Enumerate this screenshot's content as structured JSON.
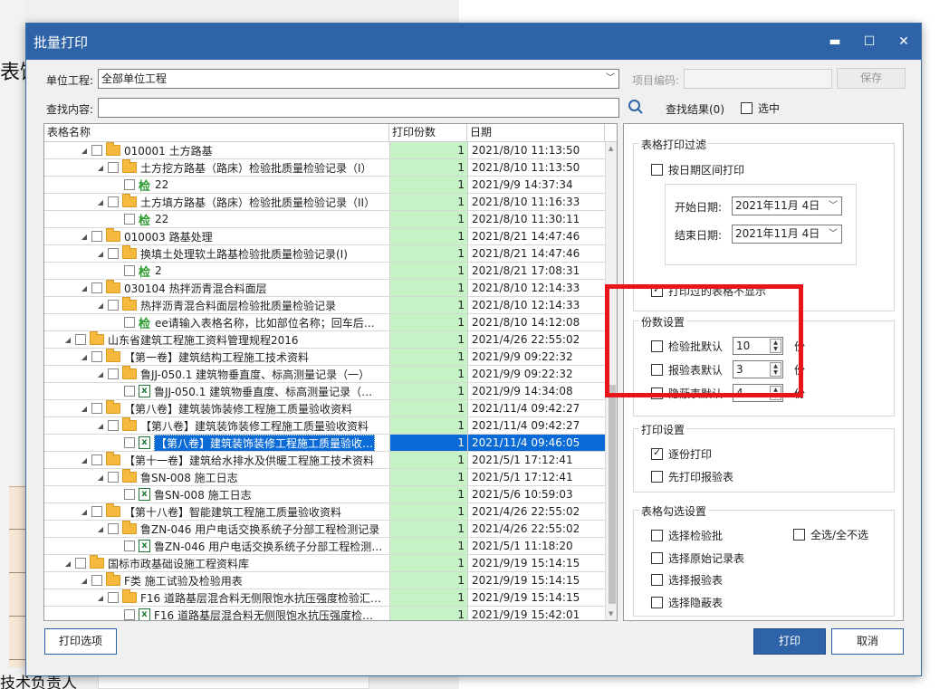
{
  "background": {
    "title_fragment": "表饰",
    "footer_fragment": "技术负责人"
  },
  "dialog": {
    "title": "批量打印",
    "minimize_glyph": "▬",
    "maximize_glyph": "☐",
    "close_glyph": "✕"
  },
  "filter": {
    "unit_label": "单位工程:",
    "unit_value": "全部单位工程",
    "project_code_label": "项目编码:",
    "project_code_value": "",
    "save_label": "保存",
    "search_label": "查找内容:",
    "search_value": "",
    "result_label": "查找结果(0)",
    "select_label": "选中"
  },
  "grid": {
    "headers": [
      "表格名称",
      "打印份数",
      "日期"
    ],
    "rows": [
      {
        "indent": 2,
        "expander": "◢",
        "icon": "folder",
        "name": "010001 土方路基",
        "copies": "1",
        "date": "2021/8/10 11:13:50"
      },
      {
        "indent": 3,
        "expander": "◢",
        "icon": "folder",
        "name": "土方挖方路基（路床）检验批质量检验记录（I）",
        "copies": "1",
        "date": "2021/8/10 11:13:50"
      },
      {
        "indent": 4,
        "expander": "",
        "icon": "jian",
        "name": "22",
        "copies": "1",
        "date": "2021/9/9 14:37:34"
      },
      {
        "indent": 3,
        "expander": "◢",
        "icon": "folder",
        "name": "土方填方路基（路床）检验批质量检验记录（II）",
        "copies": "1",
        "date": "2021/8/10 11:16:33"
      },
      {
        "indent": 4,
        "expander": "",
        "icon": "jian",
        "name": "22",
        "copies": "1",
        "date": "2021/8/10 11:30:11"
      },
      {
        "indent": 2,
        "expander": "◢",
        "icon": "folder",
        "name": "010003 路基处理",
        "copies": "1",
        "date": "2021/8/21 14:47:46"
      },
      {
        "indent": 3,
        "expander": "◢",
        "icon": "folder",
        "name": "换填土处理软土路基检验批质量检验记录(I)",
        "copies": "1",
        "date": "2021/8/21 14:47:46"
      },
      {
        "indent": 4,
        "expander": "",
        "icon": "jian",
        "name": "2",
        "copies": "1",
        "date": "2021/8/21 17:08:31"
      },
      {
        "indent": 2,
        "expander": "◢",
        "icon": "folder",
        "name": "030104 热拌沥青混合料面层",
        "copies": "1",
        "date": "2021/8/10 12:14:33"
      },
      {
        "indent": 3,
        "expander": "◢",
        "icon": "folder",
        "name": "热拌沥青混合料面层检验批质量检验记录",
        "copies": "1",
        "date": "2021/8/10 12:14:33"
      },
      {
        "indent": 4,
        "expander": "",
        "icon": "jian",
        "name": "ee请输入表格名称，比如部位名称；回车后…",
        "copies": "1",
        "date": "2021/8/10 14:12:08"
      },
      {
        "indent": 1,
        "expander": "◢",
        "icon": "folder",
        "name": "山东省建筑工程施工资料管理规程2016",
        "copies": "1",
        "date": "2021/4/26 22:55:02"
      },
      {
        "indent": 2,
        "expander": "◢",
        "icon": "folder",
        "name": "【第一卷】建筑结构工程施工技术资料",
        "copies": "1",
        "date": "2021/9/9 09:22:32"
      },
      {
        "indent": 3,
        "expander": "◢",
        "icon": "folder",
        "name": "鲁JJ-050.1 建筑物垂直度、标高测量记录（一）",
        "copies": "1",
        "date": "2021/9/9 09:22:32"
      },
      {
        "indent": 4,
        "expander": "",
        "icon": "excel",
        "name": "鲁JJ-050.1 建筑物垂直度、标高测量记录（…",
        "copies": "1",
        "date": "2021/9/9 14:34:08"
      },
      {
        "indent": 2,
        "expander": "◢",
        "icon": "folder",
        "name": "【第八卷】建筑装饰装修工程施工质量验收资料",
        "copies": "1",
        "date": "2021/11/4 09:42:27"
      },
      {
        "indent": 3,
        "expander": "◢",
        "icon": "folder",
        "name": "【第八卷】建筑装饰装修工程施工质量验收资料",
        "copies": "1",
        "date": "2021/11/4 09:42:27"
      },
      {
        "indent": 4,
        "expander": "",
        "icon": "excel",
        "name": "【第八卷】建筑装饰装修工程施工质量验收…",
        "copies": "1",
        "date": "2021/11/4 09:46:05",
        "selected": true
      },
      {
        "indent": 2,
        "expander": "◢",
        "icon": "folder",
        "name": "【第十一卷】建筑给水排水及供暖工程施工技术资料",
        "copies": "1",
        "date": "2021/5/1 17:12:41"
      },
      {
        "indent": 3,
        "expander": "◢",
        "icon": "folder",
        "name": "鲁SN-008 施工日志",
        "copies": "1",
        "date": "2021/5/1 17:12:41"
      },
      {
        "indent": 4,
        "expander": "",
        "icon": "excel",
        "name": "鲁SN-008 施工日志",
        "copies": "1",
        "date": "2021/5/6 10:59:03"
      },
      {
        "indent": 2,
        "expander": "◢",
        "icon": "folder",
        "name": "【第十八卷】智能建筑工程施工质量验收资料",
        "copies": "1",
        "date": "2021/4/26 22:55:02"
      },
      {
        "indent": 3,
        "expander": "◢",
        "icon": "folder",
        "name": "鲁ZN-046 用户电话交换系统子分部工程检测记录",
        "copies": "1",
        "date": "2021/4/26 22:55:02"
      },
      {
        "indent": 4,
        "expander": "",
        "icon": "excel",
        "name": "鲁ZN-046 用户电话交换系统子分部工程检测…",
        "copies": "1",
        "date": "2021/5/1 11:18:20"
      },
      {
        "indent": 1,
        "expander": "◢",
        "icon": "folder",
        "name": "国标市政基础设施工程资料库",
        "copies": "1",
        "date": "2021/9/19 15:14:15"
      },
      {
        "indent": 2,
        "expander": "◢",
        "icon": "folder",
        "name": "F类 施工试验及检验用表",
        "copies": "1",
        "date": "2021/9/19 15:14:15"
      },
      {
        "indent": 3,
        "expander": "◢",
        "icon": "folder",
        "name": "F16 道路基层混合料无侧限饱水抗压强度检验汇…",
        "copies": "1",
        "date": "2021/9/19 15:14:15"
      },
      {
        "indent": 4,
        "expander": "",
        "icon": "excel",
        "name": "F16 道路基层混合料无侧限饱水抗压强度检…",
        "copies": "1",
        "date": "2021/9/19 15:42:01"
      }
    ]
  },
  "right": {
    "filter_group": {
      "title": "表格打印过滤",
      "by_date_label": "按日期区间打印",
      "by_date_checked": false,
      "start_label": "开始日期:",
      "start_value": "2021年11月  4日",
      "end_label": "结束日期:",
      "end_value": "2021年11月  4日",
      "hide_printed_label": "打印过的表格不显示",
      "hide_printed_checked": true
    },
    "copies_group": {
      "title": "份数设置",
      "unit": "份",
      "items": [
        {
          "label": "检验批默认",
          "value": "10"
        },
        {
          "label": "报验表默认",
          "value": "3"
        },
        {
          "label": "隐蔽表默认",
          "value": "4"
        }
      ]
    },
    "print_group": {
      "title": "打印设置",
      "one_by_one_label": "逐份打印",
      "one_by_one_checked": true,
      "report_first_label": "先打印报验表",
      "report_first_checked": false
    },
    "select_group": {
      "title": "表格勾选设置",
      "select_all_label": "全选/全不选",
      "items": [
        "选择检验批",
        "选择原始记录表",
        "选择报验表",
        "选择隐蔽表"
      ]
    }
  },
  "footer": {
    "print_options_label": "打印选项",
    "print_label": "打印",
    "cancel_label": "取消"
  },
  "colors": {
    "accent": "#2f63a8",
    "copies_bg": "#c6f3c6",
    "selection": "#0a6ad6",
    "highlight": "#e8161a"
  }
}
